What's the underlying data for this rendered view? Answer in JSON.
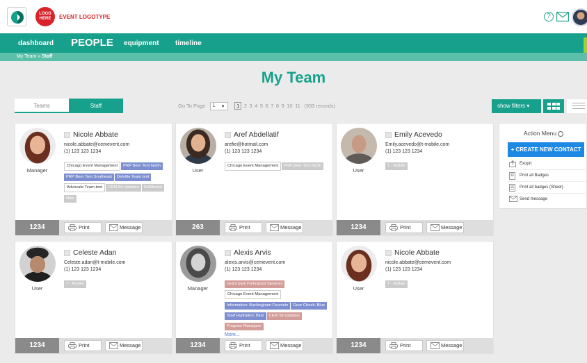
{
  "brand": {
    "logo_text": "LOGO HERE",
    "name": "EVENT LOGOTYPE"
  },
  "nav": {
    "items": [
      "dashboard",
      "PEOPLE",
      "equipment",
      "timeline"
    ],
    "active": "PEOPLE"
  },
  "breadcrumb": {
    "parent": "My Team",
    "separator": " » ",
    "current": "Staff"
  },
  "page_title": "My Team",
  "tabs": [
    "Teams",
    "Staff"
  ],
  "pager": {
    "label": "Go To Page",
    "selected": "1",
    "pages": [
      "1",
      "2",
      "3",
      "4",
      "5",
      "6",
      "7",
      "8",
      "9",
      "10",
      "11"
    ],
    "records": "(933 records)"
  },
  "show_filters_label": "show filters",
  "cards": [
    {
      "name": "Nicole Abbate",
      "email": "nicole.abbate@cemevent.com",
      "phone": "(1) 123 123 1234",
      "role": "Manager",
      "badge": "1234",
      "tags": [
        {
          "label": "Chicago Event Management",
          "style": "white"
        },
        {
          "label": "PRP Beer Tent North",
          "style": "blue"
        },
        {
          "label": "PRP Beer Tent Southeast",
          "style": "blue"
        },
        {
          "label": "Deloitte Team tent",
          "style": "blue"
        },
        {
          "label": "Advocate Team tent",
          "style": "white"
        },
        {
          "label": "CEM Sit Updates",
          "style": "gray"
        },
        {
          "label": "Fulfillment",
          "style": "gray"
        },
        {
          "label": "Nike",
          "style": "gray"
        }
      ]
    },
    {
      "name": "Aref Abdellatif",
      "email": "arefie@hotmail.com",
      "phone": "(1) 123 123 1234",
      "role": "User",
      "badge": "263",
      "tags": [
        {
          "label": "Chicago Event Management",
          "style": "white"
        },
        {
          "label": "PRP Beer Tent North",
          "style": "gray"
        }
      ]
    },
    {
      "name": "Emily Acevedo",
      "email": "Emily.acevedo@t-mobile.com",
      "phone": "(1) 123 123 1234",
      "role": "User",
      "badge": "1234",
      "tags": [
        {
          "label": "T - Mobile",
          "style": "gray"
        }
      ]
    },
    {
      "name": "Celeste Adan",
      "email": "Celeste.adan@t-mobile.com",
      "phone": "(1) 123 123 1234",
      "role": "User",
      "badge": "1234",
      "tags": [
        {
          "label": "T - Mobile",
          "style": "gray"
        }
      ]
    },
    {
      "name": "Alexis Arvis",
      "email": "alexis.arvis@cemevent.com",
      "phone": "(1) 123 123 1234",
      "role": "Manager",
      "badge": "1234",
      "tags": [
        {
          "label": "Grant park Participant Services",
          "style": "red"
        },
        {
          "label": "Chicago Event Management",
          "style": "white"
        },
        {
          "label": "Information: Buckingham Fountain",
          "style": "blue"
        },
        {
          "label": "Gear Check: Blue",
          "style": "blue"
        },
        {
          "label": "Start Hydration: Blue",
          "style": "blue"
        },
        {
          "label": "CEM Sit Updates",
          "style": "red"
        },
        {
          "label": "Program Managers",
          "style": "red"
        }
      ],
      "more": "More..."
    },
    {
      "name": "Nicole Abbate",
      "email": "nicole.abbate@cemevent.com",
      "phone": "(1) 123 123 1234",
      "role": "User",
      "badge": "1234",
      "tags": [
        {
          "label": "T - Mobile",
          "style": "gray"
        }
      ]
    }
  ],
  "card_buttons": {
    "print": "Print",
    "message": "Message"
  },
  "action_menu": {
    "title": "Action Menu",
    "create_label": "+ CREATE NEW CONTACT",
    "items": [
      "Exoprt",
      "Print all Badges",
      "Print all badges (Sheet)",
      "Send message"
    ]
  },
  "colors": {
    "primary": "#17a18c",
    "accent": "#9bd32f",
    "create_button": "#1e88e5",
    "brand_red": "#d8232a"
  }
}
